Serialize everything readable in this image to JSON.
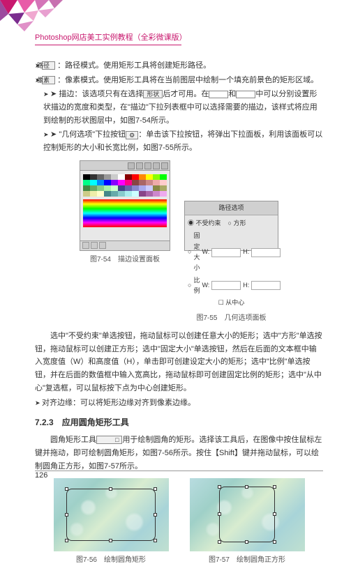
{
  "header": {
    "title": "Photoshop网店美工实例教程（全彩微课版）"
  },
  "bullets": {
    "b1_pre": " ：路径模式。使用矩形工具将创建矩形路径。",
    "b2_pre": " ：像素模式。使用矩形工具将在当前图层中绘制一个填充前景色的矩形区域。",
    "b3": "描边：该选项只有在选择 后才可用。在 和 中可以分别设置形状描边的宽度和类型，在\"描边\"下拉列表框中可以选择需要的描边，该样式将应用到绘制的形状图层中，如图7-54所示。",
    "b4": "\"几何选项\"下拉按钮 ：单击该下拉按钮，将弹出下拉面板，利用该面板可以控制矩形的大小和长宽比例，如图7-55所示。",
    "b5": "对齐边缘：可以将矩形边缘对齐到像素边缘。"
  },
  "icon_labels": {
    "path": "路径",
    "pixel": "像素"
  },
  "figcaps": {
    "f754": "图7-54　描边设置面板",
    "f755": "图7-55　几何选项面板",
    "f756": "图7-56　绘制圆角矩形",
    "f757": "图7-57　绘制圆角正方形"
  },
  "panel2": {
    "title": "路径选项",
    "radios": [
      "不受约束",
      "方形"
    ],
    "rows": [
      {
        "label": "固定大小",
        "w": "W:",
        "h": "H:"
      },
      {
        "label": "比例",
        "w": "W:",
        "h": "H:"
      }
    ],
    "check": "从中心"
  },
  "para1": "选中\"不受约束\"单选按钮，拖动鼠标可以创建任意大小的矩形；选中\"方形\"单选按钮，拖动鼠标可以创建正方形；选中\"固定大小\"单选按钮，然后在后面的文本框中输入宽度值（W）和高度值（H），单击即可创建设定大小的矩形；选中\"比例\"单选按钮，并在后面的数值框中输入宽高比，拖动鼠标即可创建固定比例的矩形；选中\"从中心\"复选框，可以鼠标按下点为中心创建矩形。",
  "section": {
    "num": "7.2.3",
    "title": "应用圆角矩形工具"
  },
  "para2": "圆角矩形工具 用于绘制圆角的矩形。选择该工具后，在图像中按住鼠标左键并拖动，即可绘制圆角矩形，如图7-56所示。按住【Shift】键并拖动鼠标，可以绘制圆角正方形，如图7-57所示。",
  "pagenum": "126"
}
